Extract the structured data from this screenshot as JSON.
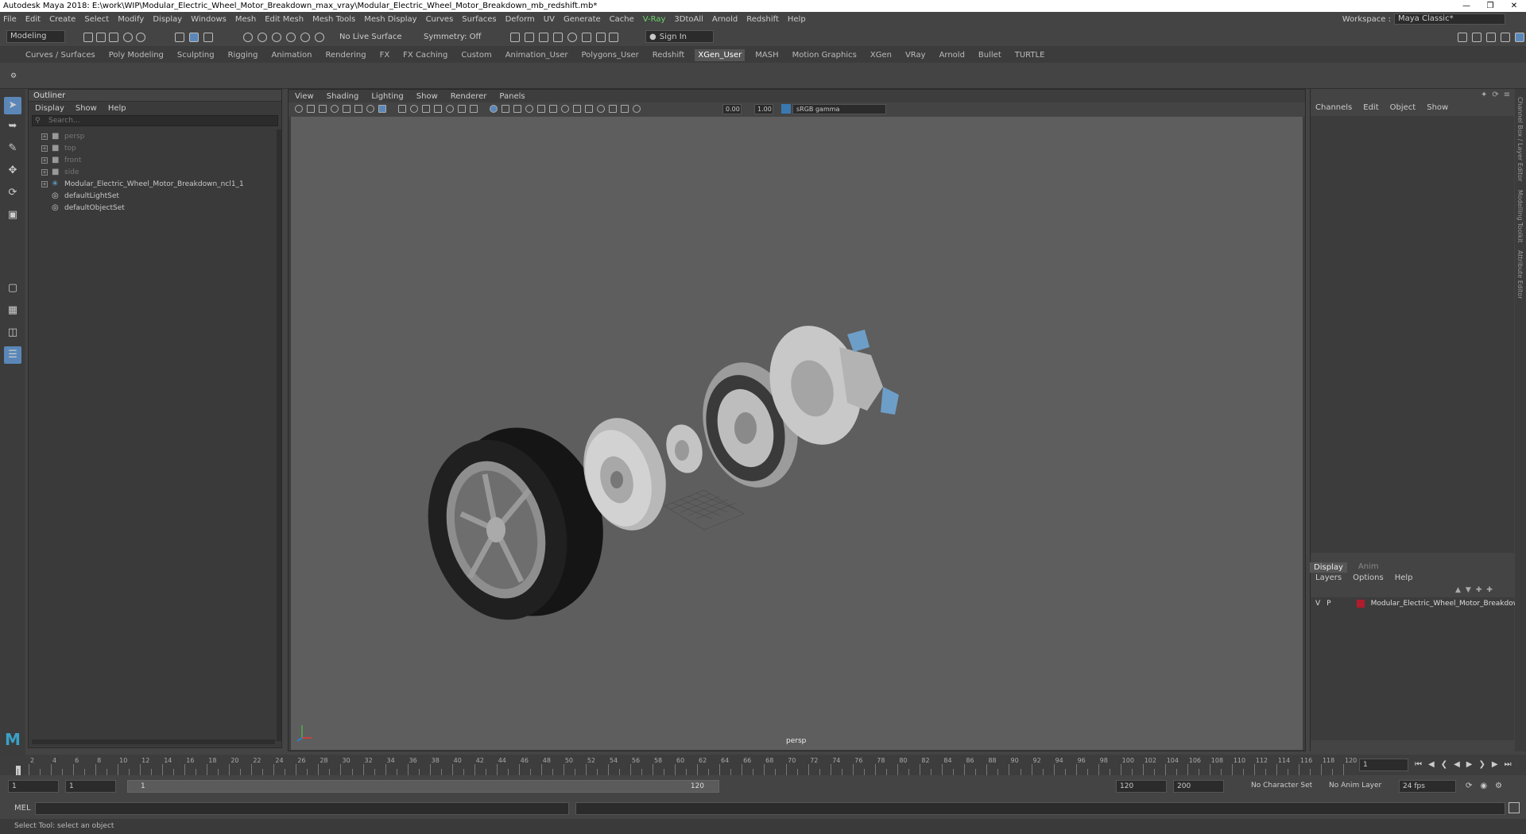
{
  "window": {
    "title": "Autodesk Maya 2018: E:\\work\\WIP\\Modular_Electric_Wheel_Motor_Breakdown_max_vray\\Modular_Electric_Wheel_Motor_Breakdown_mb_redshift.mb*"
  },
  "menubar": {
    "items": [
      "File",
      "Edit",
      "Create",
      "Select",
      "Modify",
      "Display",
      "Windows",
      "Mesh",
      "Edit Mesh",
      "Mesh Tools",
      "Mesh Display",
      "Curves",
      "Surfaces",
      "Deform",
      "UV",
      "Generate",
      "Cache",
      "V-Ray",
      "3DtoAll",
      "Arnold",
      "Redshift",
      "Help"
    ]
  },
  "workspace": {
    "label": "Workspace :",
    "value": "Maya Classic*"
  },
  "toolbar": {
    "mode": "Modeling",
    "live_surface": "No Live Surface",
    "symmetry": "Symmetry: Off",
    "sign_in": "Sign In"
  },
  "shelf": {
    "tabs": [
      "Curves / Surfaces",
      "Poly Modeling",
      "Sculpting",
      "Rigging",
      "Animation",
      "Rendering",
      "FX",
      "FX Caching",
      "Custom",
      "Animation_User",
      "Polygons_User",
      "Redshift",
      "XGen_User",
      "MASH",
      "Motion Graphics",
      "XGen",
      "VRay",
      "Arnold",
      "Bullet",
      "TURTLE"
    ],
    "active": "XGen_User"
  },
  "outliner": {
    "title": "Outliner",
    "menu": [
      "Display",
      "Show",
      "Help"
    ],
    "search_placeholder": "Search...",
    "items": [
      {
        "label": "persp"
      },
      {
        "label": "top"
      },
      {
        "label": "front"
      },
      {
        "label": "side"
      },
      {
        "label": "Modular_Electric_Wheel_Motor_Breakdown_ncl1_1"
      },
      {
        "label": "defaultLightSet"
      },
      {
        "label": "defaultObjectSet"
      }
    ]
  },
  "viewport": {
    "menu": [
      "View",
      "Shading",
      "Lighting",
      "Show",
      "Renderer",
      "Panels"
    ],
    "exposure": "0.00",
    "gamma": "1.00",
    "color_space": "sRGB gamma",
    "camera_label": "persp"
  },
  "channel_box": {
    "menu": [
      "Channels",
      "Edit",
      "Object",
      "Show"
    ]
  },
  "layer_editor": {
    "tabs": [
      "Display",
      "Anim"
    ],
    "menu": [
      "Layers",
      "Options",
      "Help"
    ],
    "layer": {
      "v": "V",
      "p": "P",
      "name": "Modular_Electric_Wheel_Motor_Breakdown",
      "color": "#b01c2c"
    }
  },
  "side_tabs": [
    "Channel Box / Layer Editor",
    "Modelling Toolkit",
    "Attribute Editor"
  ],
  "timeline": {
    "ticks": [
      "2",
      "4",
      "6",
      "8",
      "10",
      "12",
      "14",
      "16",
      "18",
      "20",
      "22",
      "24",
      "26",
      "28",
      "30",
      "32",
      "34",
      "36",
      "38",
      "40",
      "42",
      "44",
      "46",
      "48",
      "50",
      "52",
      "54",
      "56",
      "58",
      "60",
      "62",
      "64",
      "66",
      "68",
      "70",
      "72",
      "74",
      "76",
      "78",
      "80",
      "82",
      "84",
      "86",
      "88",
      "90",
      "92",
      "94",
      "96",
      "98",
      "100",
      "102",
      "104",
      "106",
      "108",
      "110",
      "112",
      "114",
      "116",
      "118",
      "120"
    ],
    "current_frame": "1"
  },
  "range": {
    "start": "1",
    "playback_start": "1",
    "slider_start": "1",
    "slider_end": "120",
    "playback_end": "120",
    "end": "200",
    "character_set": "No Character Set",
    "anim_layer": "No Anim Layer",
    "fps": "24 fps"
  },
  "command": {
    "label": "MEL"
  },
  "help_line": "Select Tool: select an object"
}
